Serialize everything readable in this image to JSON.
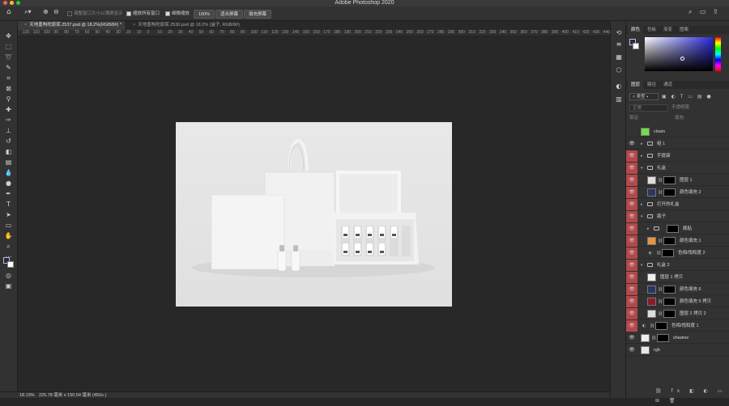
{
  "app": {
    "title": "Adobe Photoshop 2020"
  },
  "options": {
    "scroll_all_label": "调整窗口大小以满屏显示",
    "zoom_all_label": "缩放所有窗口",
    "scrubby_label": "细微缩放",
    "zoom_value": "100%",
    "fit_screen": "适合屏幕",
    "fill_screen": "填充屏幕"
  },
  "tabs": [
    {
      "label": "天地盖构砣原浆.2537.psd @ 18.2%(RGB/8#) *"
    },
    {
      "label": "天地盖构砣原浆.2530.psd @ 18.2% (盒子, RGB/8#)"
    }
  ],
  "ruler": {
    "labels": [
      "120",
      "110",
      "100",
      "90",
      "80",
      "70",
      "60",
      "50",
      "40",
      "30",
      "20",
      "10",
      "0",
      "10",
      "20",
      "30",
      "40",
      "50",
      "60",
      "70",
      "80",
      "90",
      "100",
      "110",
      "120",
      "130",
      "140",
      "150",
      "160",
      "170",
      "180",
      "190",
      "200",
      "210",
      "220",
      "230",
      "240",
      "250",
      "260",
      "270",
      "280",
      "290",
      "300",
      "310",
      "320",
      "330",
      "340",
      "350",
      "360",
      "370",
      "380",
      "390",
      "400",
      "410",
      "420",
      "430",
      "440"
    ]
  },
  "status": {
    "zoom": "18.19%",
    "doc_size": "225.78 毫米 x 150.54 毫米 (450...)"
  },
  "color_panel": {
    "tabs": [
      "颜色",
      "色板",
      "渐变",
      "图案"
    ],
    "colors": {
      "background_panel": "#323232",
      "accent": "#b3484b"
    }
  },
  "layers_panel": {
    "tabs": [
      "图层",
      "路径",
      "通道"
    ],
    "filter_kind": "类型",
    "blend_mode": "正常",
    "opacity_label": "不透明度:",
    "lock_label": "锁定:",
    "fill_label": "填充:",
    "layers": [
      {
        "name": "clown",
        "eye": false,
        "red": false,
        "type": "thumb",
        "indent": 0,
        "thumb": "#6fe04a"
      },
      {
        "name": "组 1",
        "eye": true,
        "red": false,
        "type": "group",
        "indent": 0
      },
      {
        "name": "手提袋",
        "eye": true,
        "red": true,
        "type": "group",
        "indent": 0
      },
      {
        "name": "礼盒",
        "eye": true,
        "red": true,
        "type": "group-open",
        "indent": 0
      },
      {
        "name": "图层 1",
        "eye": true,
        "red": true,
        "type": "masked",
        "indent": 1,
        "thumb": "#dddddd"
      },
      {
        "name": "颜色填充 2",
        "eye": true,
        "red": true,
        "type": "masked",
        "indent": 1,
        "thumb": "#2c3462"
      },
      {
        "name": "打开的礼盒",
        "eye": true,
        "red": true,
        "type": "group",
        "indent": 0
      },
      {
        "name": "瓶子",
        "eye": true,
        "red": true,
        "type": "group-open",
        "indent": 0
      },
      {
        "name": "瓶贴",
        "eye": true,
        "red": true,
        "type": "group-mask",
        "indent": 1
      },
      {
        "name": "颜色填充 1",
        "eye": true,
        "red": true,
        "type": "masked",
        "indent": 1,
        "thumb": "#e8963c"
      },
      {
        "name": "色相/饱和度 2",
        "eye": true,
        "red": true,
        "type": "adjust",
        "indent": 1
      },
      {
        "name": "礼盒 2",
        "eye": true,
        "red": true,
        "type": "group-open",
        "indent": 0
      },
      {
        "name": "图层 1 拷贝",
        "eye": true,
        "red": true,
        "type": "thumb",
        "indent": 1,
        "thumb": "#ededed"
      },
      {
        "name": "颜色填充 6",
        "eye": true,
        "red": true,
        "type": "masked",
        "indent": 1,
        "thumb": "#2c3462"
      },
      {
        "name": "颜色填充 5 拷贝",
        "eye": true,
        "red": true,
        "type": "masked",
        "indent": 1,
        "thumb": "#8a1a24"
      },
      {
        "name": "图层 2 拷贝 2",
        "eye": true,
        "red": true,
        "type": "masked",
        "indent": 1,
        "thumb": "#dddddd"
      },
      {
        "name": "色相/饱和度 1",
        "eye": true,
        "red": true,
        "type": "adjust",
        "indent": 0
      },
      {
        "name": "shadow",
        "eye": true,
        "red": false,
        "type": "masked",
        "indent": 0,
        "thumb": "#eeeeee"
      },
      {
        "name": "rgb",
        "eye": true,
        "red": false,
        "type": "thumb",
        "indent": 0,
        "thumb": "#e8e8e8"
      }
    ]
  }
}
